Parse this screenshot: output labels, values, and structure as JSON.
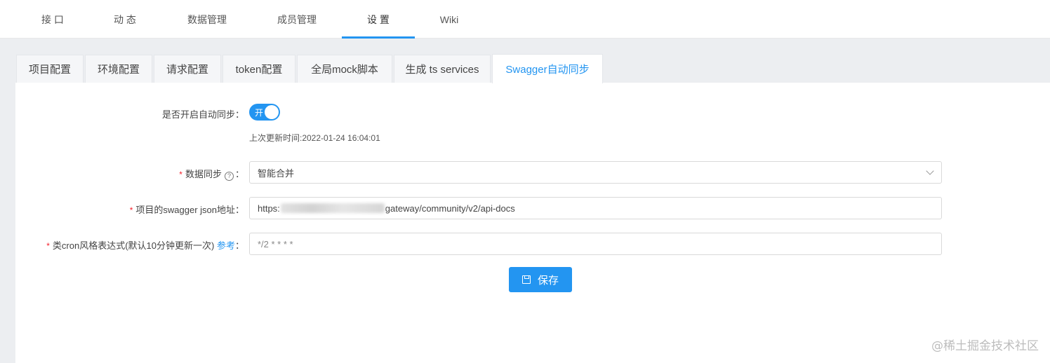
{
  "nav": {
    "items": [
      {
        "label": "接 口"
      },
      {
        "label": "动 态"
      },
      {
        "label": "数据管理"
      },
      {
        "label": "成员管理"
      },
      {
        "label": "设 置"
      },
      {
        "label": "Wiki"
      }
    ],
    "active_index": 4
  },
  "tabs": {
    "items": [
      {
        "label": "项目配置"
      },
      {
        "label": "环境配置"
      },
      {
        "label": "请求配置"
      },
      {
        "label": "token配置"
      },
      {
        "label": "全局mock脚本"
      },
      {
        "label": "生成 ts services"
      },
      {
        "label": "Swagger自动同步"
      }
    ],
    "active_index": 6
  },
  "form": {
    "auto_sync": {
      "label": "是否开启自动同步：",
      "switch_text": "开",
      "enabled": true,
      "last_update": "上次更新时间:2022-01-24 16:04:01"
    },
    "data_sync": {
      "label": "数据同步",
      "help": "?",
      "colon": "：",
      "value": "智能合并"
    },
    "swagger_url": {
      "label": "项目的swagger json地址：",
      "value_prefix": "https:",
      "value_suffix": "gateway/community/v2/api-docs"
    },
    "cron": {
      "label": "类cron风格表达式(默认10分钟更新一次)",
      "link": "参考",
      "colon": "：",
      "value": "*/2 * * * *"
    },
    "required_mark": "*",
    "save_label": "保存"
  },
  "watermark": "@稀土掘金技术社区",
  "colors": {
    "accent": "#2395f1",
    "required": "#f5222d"
  }
}
